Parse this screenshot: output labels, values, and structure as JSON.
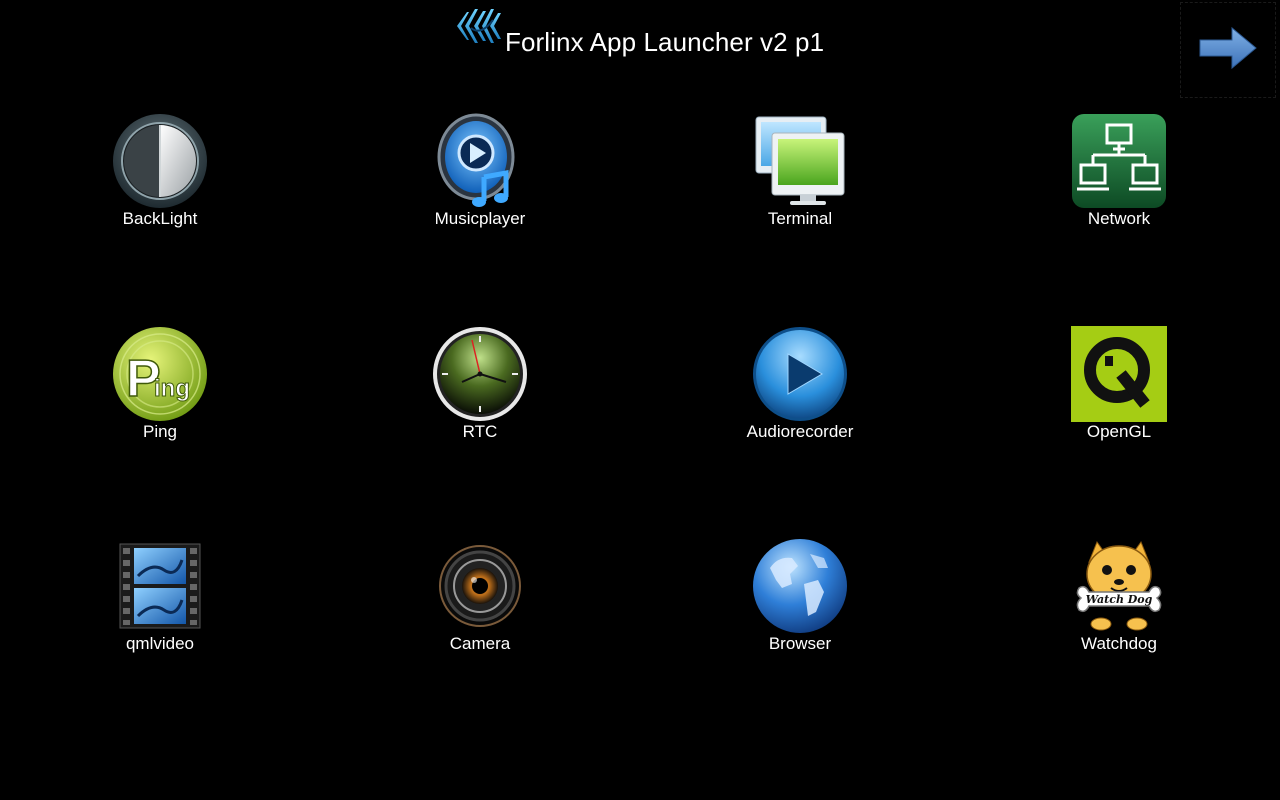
{
  "header": {
    "title": "Forlinx App Launcher v2 p1",
    "logo_icon": "forlinx-logo-icon"
  },
  "navigation": {
    "next_icon": "arrow-right-icon",
    "arrow_color": "#5b8fcf"
  },
  "apps": [
    {
      "label": "BackLight",
      "icon": "backlight-icon"
    },
    {
      "label": "Musicplayer",
      "icon": "musicplayer-icon"
    },
    {
      "label": "Terminal",
      "icon": "terminal-icon"
    },
    {
      "label": "Network",
      "icon": "network-icon"
    },
    {
      "label": "Ping",
      "icon": "ping-icon"
    },
    {
      "label": "RTC",
      "icon": "clock-icon"
    },
    {
      "label": "Audiorecorder",
      "icon": "play-icon"
    },
    {
      "label": "OpenGL",
      "icon": "qt-opengl-icon"
    },
    {
      "label": "qmlvideo",
      "icon": "film-strip-icon"
    },
    {
      "label": "Camera",
      "icon": "camera-lens-icon"
    },
    {
      "label": "Browser",
      "icon": "globe-icon"
    },
    {
      "label": "Watchdog",
      "icon": "watchdog-icon"
    }
  ],
  "ping_icon_text": {
    "big": "P",
    "small": "ing"
  },
  "watchdog_icon_text": "Watch Dog"
}
